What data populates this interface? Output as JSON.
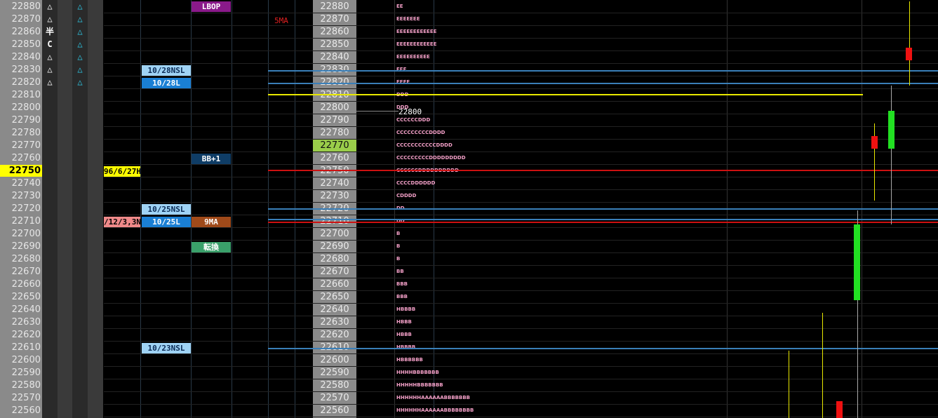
{
  "prices": [
    "22880",
    "22870",
    "22860",
    "22850",
    "22840",
    "22830",
    "22820",
    "22810",
    "22800",
    "22790",
    "22780",
    "22770",
    "22760",
    "22750",
    "22740",
    "22730",
    "22720",
    "22710",
    "22700",
    "22690",
    "22680",
    "22670",
    "22660",
    "22650",
    "22640",
    "22630",
    "22620",
    "22610",
    "22600",
    "22590",
    "22580",
    "22570",
    "22560"
  ],
  "highlight_left": "22750",
  "highlight_mid": "22770",
  "col1_marks": [
    "△",
    "△",
    "半",
    "C",
    "△",
    "△",
    "△"
  ],
  "col2_marks": [
    "△",
    "△",
    "△",
    "△",
    "△",
    "△",
    "△"
  ],
  "tags": {
    "lbop": "LBOP",
    "nsl_1028": "10/28NSL",
    "l_1028": "10/28L",
    "bb1": "BB+1",
    "date_27h": "96/6/27H",
    "nsl_1025": "10/25NSL",
    "date_12_3": "/12/3,3N",
    "l_1025": "10/25L",
    "ma9": "9MA",
    "tenkan": "転換",
    "nsl_1023": "10/23NSL",
    "ma5": "5MA",
    "cursor_price": "22800"
  },
  "tpo": [
    "EE",
    "EEEEEEE",
    "EEEEEEEEEEEE",
    "EEEEEEEEEEEE",
    "EEEEEEEEEE",
    "EEE",
    "EEEE",
    "DDD",
    "DDD",
    "CCCCCCDDD",
    "CCCCCCCCCDDDD",
    "CCCCCCCCCCCDDDD",
    "CCCCCCCCCDDDDDDDDD",
    "CCCCCCDDDDDDDDDD",
    "CCCCDDDDDD",
    "CDDDD",
    "DD",
    "DD",
    "B",
    "B",
    "B",
    "BB",
    "BBB",
    "BBB",
    "HBBBB",
    "HBBB",
    "HBBB",
    "HBBBB",
    "HBBBBBB",
    "HHHHBBBBBBB",
    "HHHHHBBBBBBB",
    "HHHHHHAAAAAABBBBBBB",
    "HHHHHHAAAAAABBBBBBBB"
  ],
  "colors": {
    "accent_yellow": "#ffff00",
    "nsl_blue": "#9fd3f5",
    "l_blue": "#1a7fd4",
    "lbop_purple": "#8a1a8a",
    "bb_navy": "#0f3d66",
    "ma9_brown": "#a04a1a",
    "tenkan_green": "#3aa06a",
    "candle_green": "#22e022",
    "candle_red": "#ee1111"
  }
}
